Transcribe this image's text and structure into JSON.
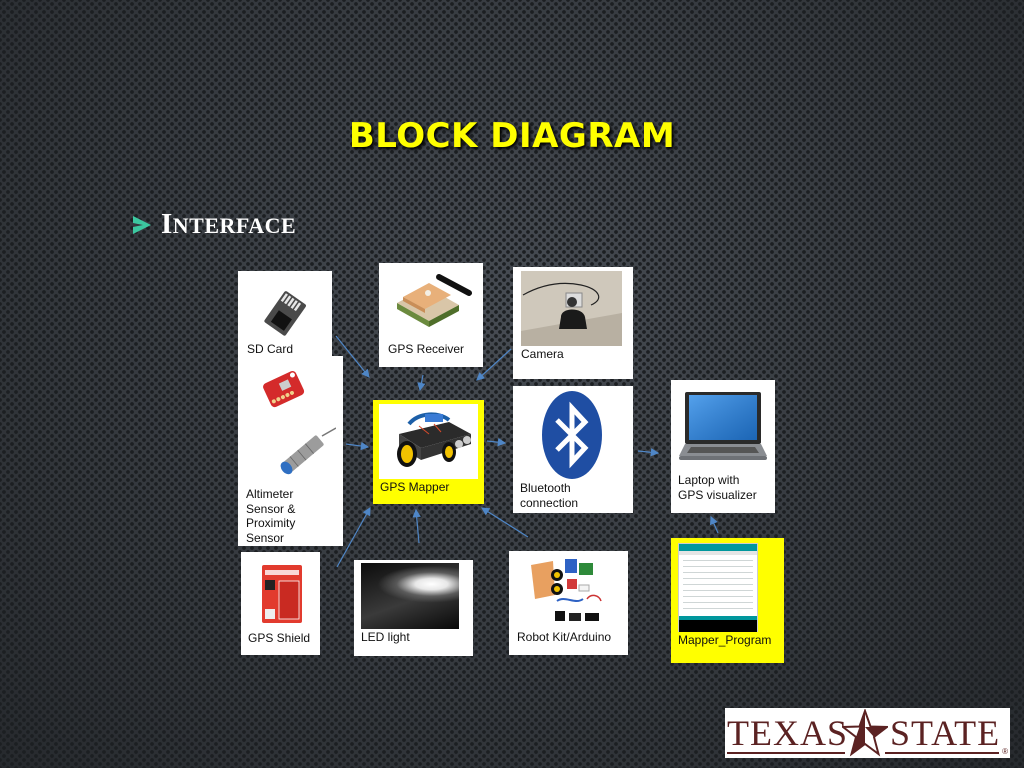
{
  "slide": {
    "title": "BLOCK DIAGRAM",
    "bullet": {
      "icon": "arrow-bullet-icon",
      "first_letter": "I",
      "rest": "NTERFACE",
      "text": "Interface"
    },
    "colors": {
      "title": "#ffff00",
      "bullet": "#3cc8a0",
      "arrow": "#4f86c6",
      "highlight_box": "#ffff00",
      "logo": "#5b2222"
    }
  },
  "blocks": {
    "sd_card": {
      "label": "SD Card",
      "image": "sd-card-image"
    },
    "gps_receiver": {
      "label": "GPS Receiver",
      "image": "gps-receiver-module-image"
    },
    "camera": {
      "label": "Camera",
      "image": "webcam-image"
    },
    "sensors": {
      "label_lines": [
        "Altimeter",
        "Sensor &",
        "Proximity",
        "Sensor"
      ],
      "image": "altimeter-and-proximity-sensor-image"
    },
    "gps_mapper": {
      "label": "GPS Mapper",
      "image": "robot-car-image"
    },
    "bluetooth": {
      "label_lines": [
        "Bluetooth",
        "connection"
      ],
      "image": "bluetooth-logo"
    },
    "laptop": {
      "label_lines": [
        "Laptop with",
        "GPS visualizer"
      ],
      "image": "laptop-image"
    },
    "gps_shield": {
      "label": "GPS Shield",
      "image": "gps-shield-package-image"
    },
    "led": {
      "label": "LED light",
      "image": "led-light-image"
    },
    "robot_kit": {
      "label": "Robot Kit/Arduino",
      "image": "robot-kit-parts-image"
    },
    "mapper_program": {
      "label": "Mapper_Program",
      "image": "arduino-ide-screenshot"
    }
  },
  "connections": [
    {
      "from": "SD Card",
      "to": "GPS Mapper"
    },
    {
      "from": "GPS Receiver",
      "to": "GPS Mapper"
    },
    {
      "from": "Camera",
      "to": "GPS Mapper"
    },
    {
      "from": "Altimeter Sensor & Proximity Sensor",
      "to": "GPS Mapper"
    },
    {
      "from": "GPS Shield",
      "to": "GPS Mapper"
    },
    {
      "from": "LED light",
      "to": "GPS Mapper"
    },
    {
      "from": "Robot Kit/Arduino",
      "to": "GPS Mapper"
    },
    {
      "from": "GPS Mapper",
      "to": "Bluetooth connection"
    },
    {
      "from": "Bluetooth connection",
      "to": "Laptop with GPS visualizer"
    },
    {
      "from": "Mapper_Program",
      "to": "Laptop with GPS visualizer"
    }
  ],
  "logo": {
    "left": "TEXAS",
    "right": "STATE",
    "registered": "®",
    "icon": "lone-star-icon"
  }
}
